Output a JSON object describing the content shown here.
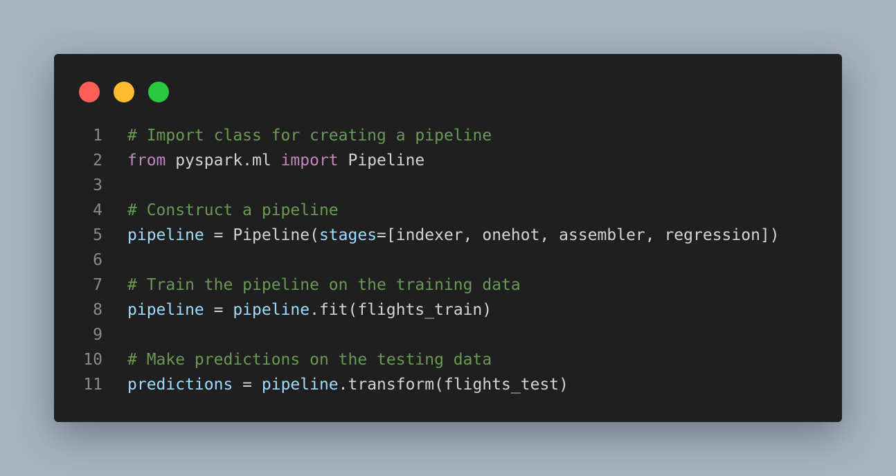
{
  "window": {
    "controls": [
      {
        "name": "close",
        "color": "#ff5f57"
      },
      {
        "name": "minimize",
        "color": "#febc2e"
      },
      {
        "name": "zoom",
        "color": "#28c840"
      }
    ]
  },
  "code": {
    "language": "python",
    "lines": [
      {
        "n": "1",
        "tokens": [
          {
            "t": "# Import class for creating a pipeline",
            "k": "comment"
          }
        ]
      },
      {
        "n": "2",
        "tokens": [
          {
            "t": "from",
            "k": "keyword"
          },
          {
            "t": " pyspark.ml ",
            "k": "plain"
          },
          {
            "t": "import",
            "k": "keyword"
          },
          {
            "t": " Pipeline",
            "k": "plain"
          }
        ]
      },
      {
        "n": "3",
        "tokens": []
      },
      {
        "n": "4",
        "tokens": [
          {
            "t": "# Construct a pipeline",
            "k": "comment"
          }
        ]
      },
      {
        "n": "5",
        "tokens": [
          {
            "t": "pipeline",
            "k": "var"
          },
          {
            "t": " = Pipeline(",
            "k": "plain"
          },
          {
            "t": "stages",
            "k": "var"
          },
          {
            "t": "=[indexer, onehot, assembler, regression])",
            "k": "plain"
          }
        ]
      },
      {
        "n": "6",
        "tokens": []
      },
      {
        "n": "7",
        "tokens": [
          {
            "t": "# Train the pipeline on the training data",
            "k": "comment"
          }
        ]
      },
      {
        "n": "8",
        "tokens": [
          {
            "t": "pipeline",
            "k": "var"
          },
          {
            "t": " = ",
            "k": "plain"
          },
          {
            "t": "pipeline",
            "k": "var"
          },
          {
            "t": ".fit(flights_train)",
            "k": "plain"
          }
        ]
      },
      {
        "n": "9",
        "tokens": []
      },
      {
        "n": "10",
        "tokens": [
          {
            "t": "# Make predictions on the testing data",
            "k": "comment"
          }
        ]
      },
      {
        "n": "11",
        "tokens": [
          {
            "t": "predictions",
            "k": "var"
          },
          {
            "t": " = ",
            "k": "plain"
          },
          {
            "t": "pipeline",
            "k": "var"
          },
          {
            "t": ".transform(flights_test)",
            "k": "plain"
          }
        ]
      }
    ]
  },
  "colors": {
    "background": "#a7b3c1",
    "window": "#1f1f1f",
    "comment": "#6a9955",
    "keyword": "#c586c0",
    "variable": "#9cdcfe",
    "plain": "#d4d4d4",
    "line_number": "#8a8a8a"
  }
}
